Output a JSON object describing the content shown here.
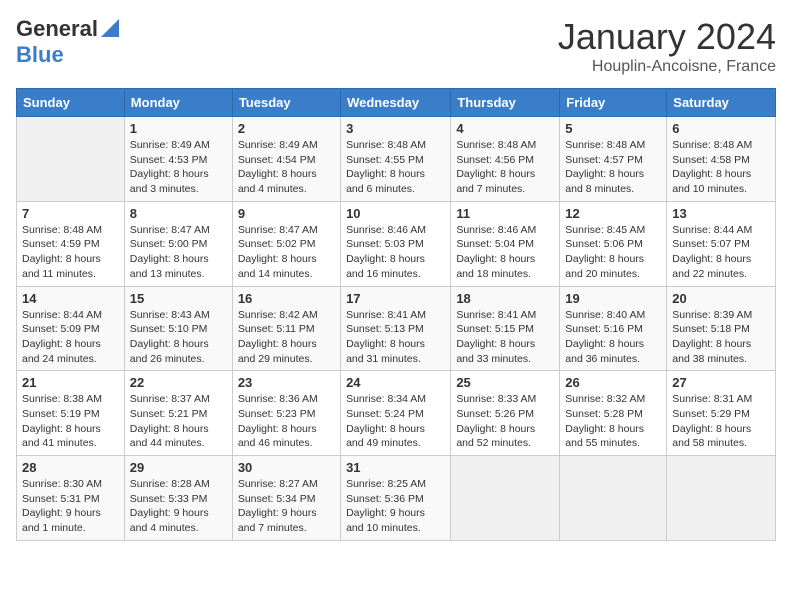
{
  "header": {
    "logo_general": "General",
    "logo_blue": "Blue",
    "month_title": "January 2024",
    "location": "Houplin-Ancoisne, France"
  },
  "days_of_week": [
    "Sunday",
    "Monday",
    "Tuesday",
    "Wednesday",
    "Thursday",
    "Friday",
    "Saturday"
  ],
  "weeks": [
    [
      {
        "day": "",
        "info": ""
      },
      {
        "day": "1",
        "info": "Sunrise: 8:49 AM\nSunset: 4:53 PM\nDaylight: 8 hours\nand 3 minutes."
      },
      {
        "day": "2",
        "info": "Sunrise: 8:49 AM\nSunset: 4:54 PM\nDaylight: 8 hours\nand 4 minutes."
      },
      {
        "day": "3",
        "info": "Sunrise: 8:48 AM\nSunset: 4:55 PM\nDaylight: 8 hours\nand 6 minutes."
      },
      {
        "day": "4",
        "info": "Sunrise: 8:48 AM\nSunset: 4:56 PM\nDaylight: 8 hours\nand 7 minutes."
      },
      {
        "day": "5",
        "info": "Sunrise: 8:48 AM\nSunset: 4:57 PM\nDaylight: 8 hours\nand 8 minutes."
      },
      {
        "day": "6",
        "info": "Sunrise: 8:48 AM\nSunset: 4:58 PM\nDaylight: 8 hours\nand 10 minutes."
      }
    ],
    [
      {
        "day": "7",
        "info": "Sunrise: 8:48 AM\nSunset: 4:59 PM\nDaylight: 8 hours\nand 11 minutes."
      },
      {
        "day": "8",
        "info": "Sunrise: 8:47 AM\nSunset: 5:00 PM\nDaylight: 8 hours\nand 13 minutes."
      },
      {
        "day": "9",
        "info": "Sunrise: 8:47 AM\nSunset: 5:02 PM\nDaylight: 8 hours\nand 14 minutes."
      },
      {
        "day": "10",
        "info": "Sunrise: 8:46 AM\nSunset: 5:03 PM\nDaylight: 8 hours\nand 16 minutes."
      },
      {
        "day": "11",
        "info": "Sunrise: 8:46 AM\nSunset: 5:04 PM\nDaylight: 8 hours\nand 18 minutes."
      },
      {
        "day": "12",
        "info": "Sunrise: 8:45 AM\nSunset: 5:06 PM\nDaylight: 8 hours\nand 20 minutes."
      },
      {
        "day": "13",
        "info": "Sunrise: 8:44 AM\nSunset: 5:07 PM\nDaylight: 8 hours\nand 22 minutes."
      }
    ],
    [
      {
        "day": "14",
        "info": "Sunrise: 8:44 AM\nSunset: 5:09 PM\nDaylight: 8 hours\nand 24 minutes."
      },
      {
        "day": "15",
        "info": "Sunrise: 8:43 AM\nSunset: 5:10 PM\nDaylight: 8 hours\nand 26 minutes."
      },
      {
        "day": "16",
        "info": "Sunrise: 8:42 AM\nSunset: 5:11 PM\nDaylight: 8 hours\nand 29 minutes."
      },
      {
        "day": "17",
        "info": "Sunrise: 8:41 AM\nSunset: 5:13 PM\nDaylight: 8 hours\nand 31 minutes."
      },
      {
        "day": "18",
        "info": "Sunrise: 8:41 AM\nSunset: 5:15 PM\nDaylight: 8 hours\nand 33 minutes."
      },
      {
        "day": "19",
        "info": "Sunrise: 8:40 AM\nSunset: 5:16 PM\nDaylight: 8 hours\nand 36 minutes."
      },
      {
        "day": "20",
        "info": "Sunrise: 8:39 AM\nSunset: 5:18 PM\nDaylight: 8 hours\nand 38 minutes."
      }
    ],
    [
      {
        "day": "21",
        "info": "Sunrise: 8:38 AM\nSunset: 5:19 PM\nDaylight: 8 hours\nand 41 minutes."
      },
      {
        "day": "22",
        "info": "Sunrise: 8:37 AM\nSunset: 5:21 PM\nDaylight: 8 hours\nand 44 minutes."
      },
      {
        "day": "23",
        "info": "Sunrise: 8:36 AM\nSunset: 5:23 PM\nDaylight: 8 hours\nand 46 minutes."
      },
      {
        "day": "24",
        "info": "Sunrise: 8:34 AM\nSunset: 5:24 PM\nDaylight: 8 hours\nand 49 minutes."
      },
      {
        "day": "25",
        "info": "Sunrise: 8:33 AM\nSunset: 5:26 PM\nDaylight: 8 hours\nand 52 minutes."
      },
      {
        "day": "26",
        "info": "Sunrise: 8:32 AM\nSunset: 5:28 PM\nDaylight: 8 hours\nand 55 minutes."
      },
      {
        "day": "27",
        "info": "Sunrise: 8:31 AM\nSunset: 5:29 PM\nDaylight: 8 hours\nand 58 minutes."
      }
    ],
    [
      {
        "day": "28",
        "info": "Sunrise: 8:30 AM\nSunset: 5:31 PM\nDaylight: 9 hours\nand 1 minute."
      },
      {
        "day": "29",
        "info": "Sunrise: 8:28 AM\nSunset: 5:33 PM\nDaylight: 9 hours\nand 4 minutes."
      },
      {
        "day": "30",
        "info": "Sunrise: 8:27 AM\nSunset: 5:34 PM\nDaylight: 9 hours\nand 7 minutes."
      },
      {
        "day": "31",
        "info": "Sunrise: 8:25 AM\nSunset: 5:36 PM\nDaylight: 9 hours\nand 10 minutes."
      },
      {
        "day": "",
        "info": ""
      },
      {
        "day": "",
        "info": ""
      },
      {
        "day": "",
        "info": ""
      }
    ]
  ]
}
